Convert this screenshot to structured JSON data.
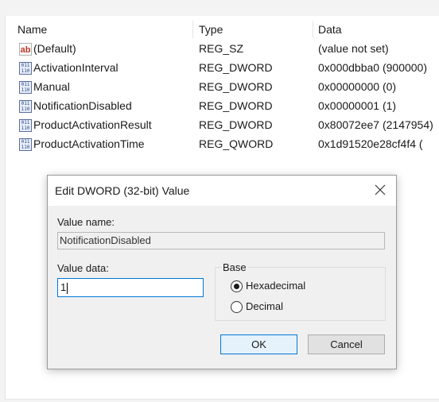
{
  "list": {
    "columns": [
      "Name",
      "Type",
      "Data"
    ],
    "rows": [
      {
        "icon": "string-value-icon",
        "name": "(Default)",
        "type": "REG_SZ",
        "data": "(value not set)"
      },
      {
        "icon": "binary-value-icon",
        "name": "ActivationInterval",
        "type": "REG_DWORD",
        "data": "0x000dbba0 (900000)"
      },
      {
        "icon": "binary-value-icon",
        "name": "Manual",
        "type": "REG_DWORD",
        "data": "0x00000000 (0)"
      },
      {
        "icon": "binary-value-icon",
        "name": "NotificationDisabled",
        "type": "REG_DWORD",
        "data": "0x00000001 (1)"
      },
      {
        "icon": "binary-value-icon",
        "name": "ProductActivationResult",
        "type": "REG_DWORD",
        "data": "0x80072ee7 (2147954)"
      },
      {
        "icon": "binary-value-icon",
        "name": "ProductActivationTime",
        "type": "REG_QWORD",
        "data": "0x1d91520e28cf4f4 ("
      }
    ]
  },
  "dialog": {
    "title": "Edit DWORD (32-bit) Value",
    "value_name_label": "Value name:",
    "value_name": "NotificationDisabled",
    "value_data_label": "Value data:",
    "value_data": "1",
    "base_label": "Base",
    "base_options": [
      {
        "label": "Hexadecimal",
        "selected": true
      },
      {
        "label": "Decimal",
        "selected": false
      }
    ],
    "ok_label": "OK",
    "cancel_label": "Cancel"
  }
}
